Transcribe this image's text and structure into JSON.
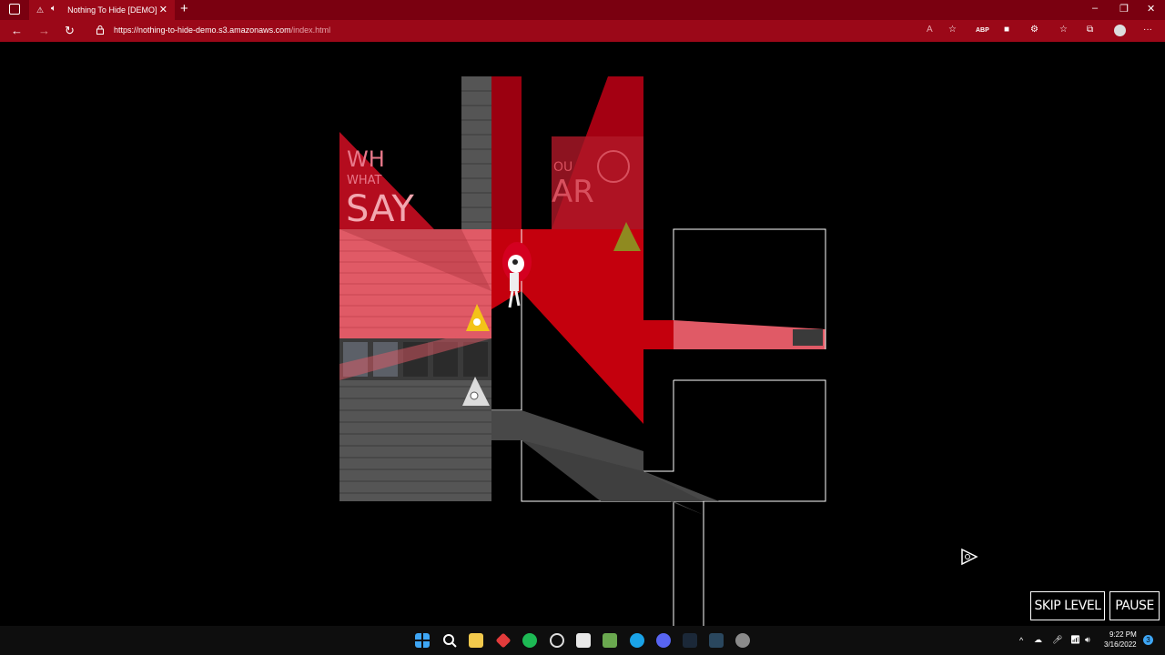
{
  "browser": {
    "tab_title": "Nothing To Hide [DEMO]",
    "url_host": "https://nothing-to-hide-demo.s3.amazonaws.com",
    "url_path": "/index.html"
  },
  "game": {
    "poster_left_line1": "WH",
    "poster_left_line2": "WHAT",
    "poster_left_line3": "SAY",
    "poster_right_line1": "OU",
    "poster_right_line2": "AR",
    "skip_label": "SKIP LEVEL",
    "pause_label": "PAUSE"
  },
  "taskbar": {
    "time": "9:22 PM",
    "date": "3/16/2022",
    "notification_count": "3"
  },
  "icons": [
    "window-menu-icon",
    "tab-warning-icon",
    "speaker-icon",
    "close-icon",
    "plus-icon",
    "back-icon",
    "forward-icon",
    "refresh-icon",
    "lock-icon",
    "read-aloud-icon",
    "favorite-star-icon",
    "abp-icon",
    "extension-icon",
    "puzzle-icon",
    "favorites-icon",
    "collections-icon",
    "profile-icon",
    "more-icon",
    "cursor-icon",
    "windows-start-icon",
    "search-icon",
    "file-explorer-icon",
    "spotify-icon",
    "steam-icon",
    "settings-icon",
    "wifi-icon",
    "volume-icon",
    "microphone-icon",
    "onedrive-icon"
  ],
  "colors": {
    "chrome": "#9b0818",
    "light_red": "#e05a66",
    "red": "#c4000d",
    "dark_red": "#7a0008"
  }
}
